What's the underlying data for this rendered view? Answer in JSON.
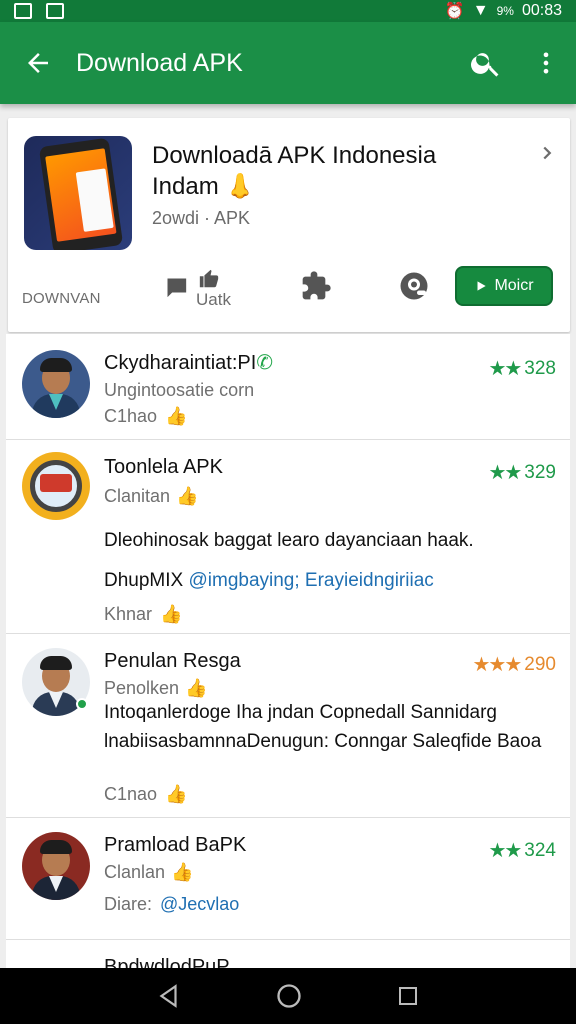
{
  "status_bar": {
    "battery": "9%",
    "time": "00:83"
  },
  "app_bar": {
    "title": "Download APK"
  },
  "app_card": {
    "title": "Downloadā APK Indonesia Indam",
    "emoji": "👃",
    "meta": "2owdi · APK",
    "download_label": "DOWNVAN",
    "action_label": "Uatk",
    "install_label": "Moicr",
    "colors": {
      "green": "#1b8f47",
      "install": "#168a3f"
    }
  },
  "items": [
    {
      "name": "Ckydharaintiat:PI",
      "badge_icon": "whatsapp-icon",
      "sub": "Ungintoosatie corn",
      "foot": "C1hao",
      "stars": "★★",
      "rating": "328"
    },
    {
      "name": "Toonlela APK",
      "sub": "Clanitan",
      "stars": "★★",
      "rating": "329",
      "body": "Dleohinosak baggat learo dayanciaan haak.",
      "body2_prefix": "DhupMIX",
      "body2_link": "@imgbaying; Erayieidngiriiac",
      "foot": "Khnar"
    },
    {
      "name": "Penulan Resga",
      "sub": "Penolken",
      "stars": "★★★",
      "rating": "290",
      "body": "Intoqanlerdoge Iha jndan Copnedall Sannidarg lnabiisasbamnnaDenugun: Conngar Saleqfide Baoa",
      "foot": "C1nao"
    },
    {
      "name": "Pramload BaPK",
      "sub": "Clanlan",
      "stars": "★★",
      "rating": "324",
      "foot_label": "Diare:",
      "foot_link": "@Jecvlao"
    }
  ],
  "partial_item": {
    "name": "BpdwdlodPuP"
  }
}
